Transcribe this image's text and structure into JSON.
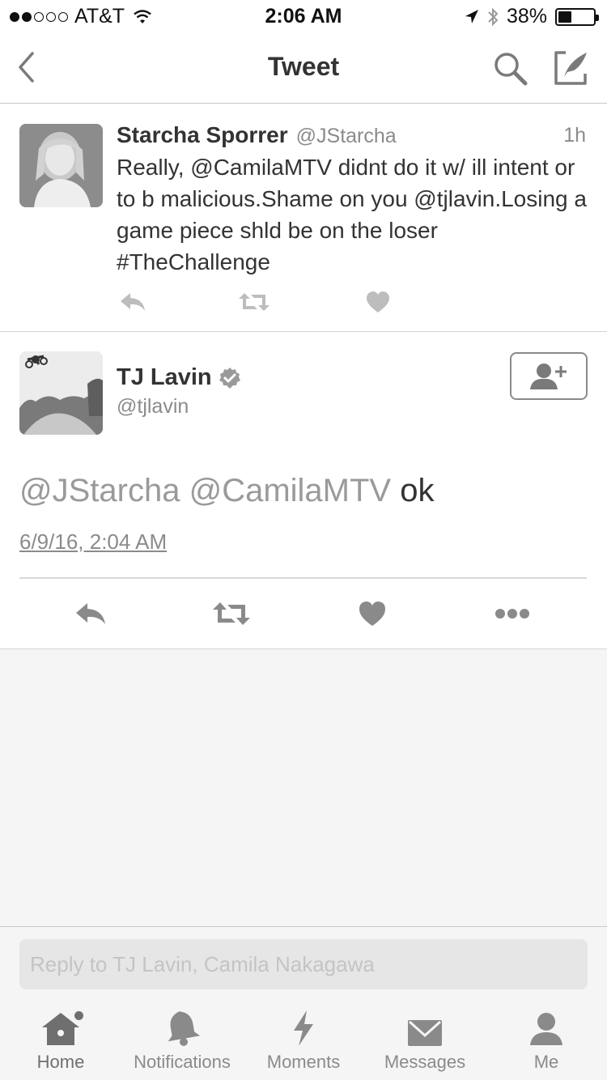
{
  "status_bar": {
    "carrier": "AT&T",
    "time": "2:06 AM",
    "battery": "38%",
    "battery_level": 0.38,
    "signal_bars_filled": 2,
    "signal_bars_total": 5
  },
  "nav": {
    "title": "Tweet",
    "icons": [
      "back-chevron-icon",
      "search-icon",
      "compose-icon"
    ]
  },
  "parent_tweet": {
    "name": "Starcha Sporrer",
    "handle": "@JStarcha",
    "time": "1h",
    "text": "Really, @CamilaMTV didnt do it w/ ill intent or to b malicious.Shame on you @tjlavin.Losing a game piece shld be on the loser #TheChallenge",
    "actions": [
      "reply-icon",
      "retweet-icon",
      "like-icon"
    ]
  },
  "main_tweet": {
    "name": "TJ Lavin",
    "verified": true,
    "handle": "@tjlavin",
    "mention_1": "@JStarcha",
    "mention_2": "@CamilaMTV",
    "body": "ok",
    "date": "6/9/16, 2:04 AM",
    "actions": [
      "reply-icon",
      "retweet-icon",
      "like-icon",
      "more-icon"
    ]
  },
  "reply": {
    "placeholder": "Reply to TJ Lavin, Camila Nakagawa"
  },
  "tab_bar": {
    "active": "home",
    "tabs": [
      {
        "id": "home",
        "label": "Home"
      },
      {
        "id": "notifications",
        "label": "Notifications"
      },
      {
        "id": "moments",
        "label": "Moments"
      },
      {
        "id": "messages",
        "label": "Messages"
      },
      {
        "id": "me",
        "label": "Me"
      }
    ]
  },
  "colors": {
    "text_primary": "#333333",
    "text_secondary": "#8b8b8b",
    "icon_gray": "#8a8a8a",
    "background_gray": "#f5f5f5",
    "divider": "#d5d5d5"
  }
}
